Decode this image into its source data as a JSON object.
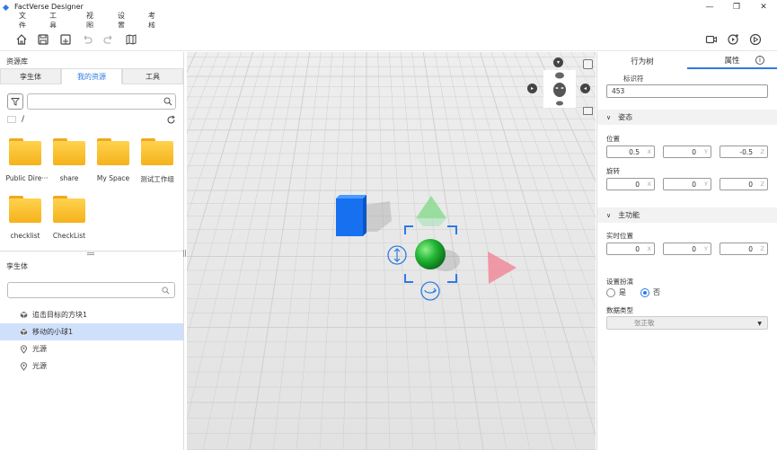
{
  "app": {
    "title": "FactVerse Designer"
  },
  "window": {
    "minimize": "—",
    "restore": "❐",
    "close": "✕"
  },
  "menu": [
    "文件",
    "工具",
    "视图",
    "设置",
    "考核"
  ],
  "library": {
    "title": "资源库",
    "tabs": [
      "孪生体",
      "我的资源",
      "工具"
    ],
    "active_tab": "我的资源",
    "search_placeholder": "",
    "path": "/",
    "folders": [
      "Public Dire···",
      "share",
      "My Space",
      "测试工作组",
      "checklist",
      "CheckList"
    ]
  },
  "twins": {
    "title": "孪生体",
    "search_placeholder": "",
    "items": [
      {
        "label": "追击目标的方块1",
        "icon": "cube-icon",
        "selected": false
      },
      {
        "label": "移动的小球1",
        "icon": "cube-icon",
        "selected": true
      },
      {
        "label": "光源",
        "icon": "light-icon",
        "selected": false
      },
      {
        "label": "光源",
        "icon": "light-icon",
        "selected": false
      }
    ]
  },
  "properties": {
    "tabs": [
      "行为树",
      "属性"
    ],
    "active_tab": "属性",
    "info_icon": "i",
    "identifier_label": "标识符",
    "identifier_value": "453",
    "pose_section": "姿态",
    "position_label": "位置",
    "position": {
      "x": "0.5",
      "y": "0",
      "z": "-0.5"
    },
    "rotation_label": "旋转",
    "rotation": {
      "x": "0",
      "y": "0",
      "z": "0"
    },
    "main_section": "主功能",
    "realtime_label": "实时位置",
    "realtime": {
      "x": "0",
      "y": "0",
      "z": "0"
    },
    "axis_labels": {
      "x": "X",
      "y": "Y",
      "z": "Z"
    },
    "acting_label": "设置扮演",
    "acting_options": [
      "是",
      "否"
    ],
    "acting_selected": "否",
    "data_type_label": "数据类型",
    "data_type_value": "张正敬"
  },
  "colors": {
    "accent": "#2c7be5",
    "cube": "#1670f0",
    "sphere": "#1fa82f",
    "gizmo_y": "#7fd88a",
    "gizmo_x": "#f08090",
    "selection": "#2c7be5"
  }
}
